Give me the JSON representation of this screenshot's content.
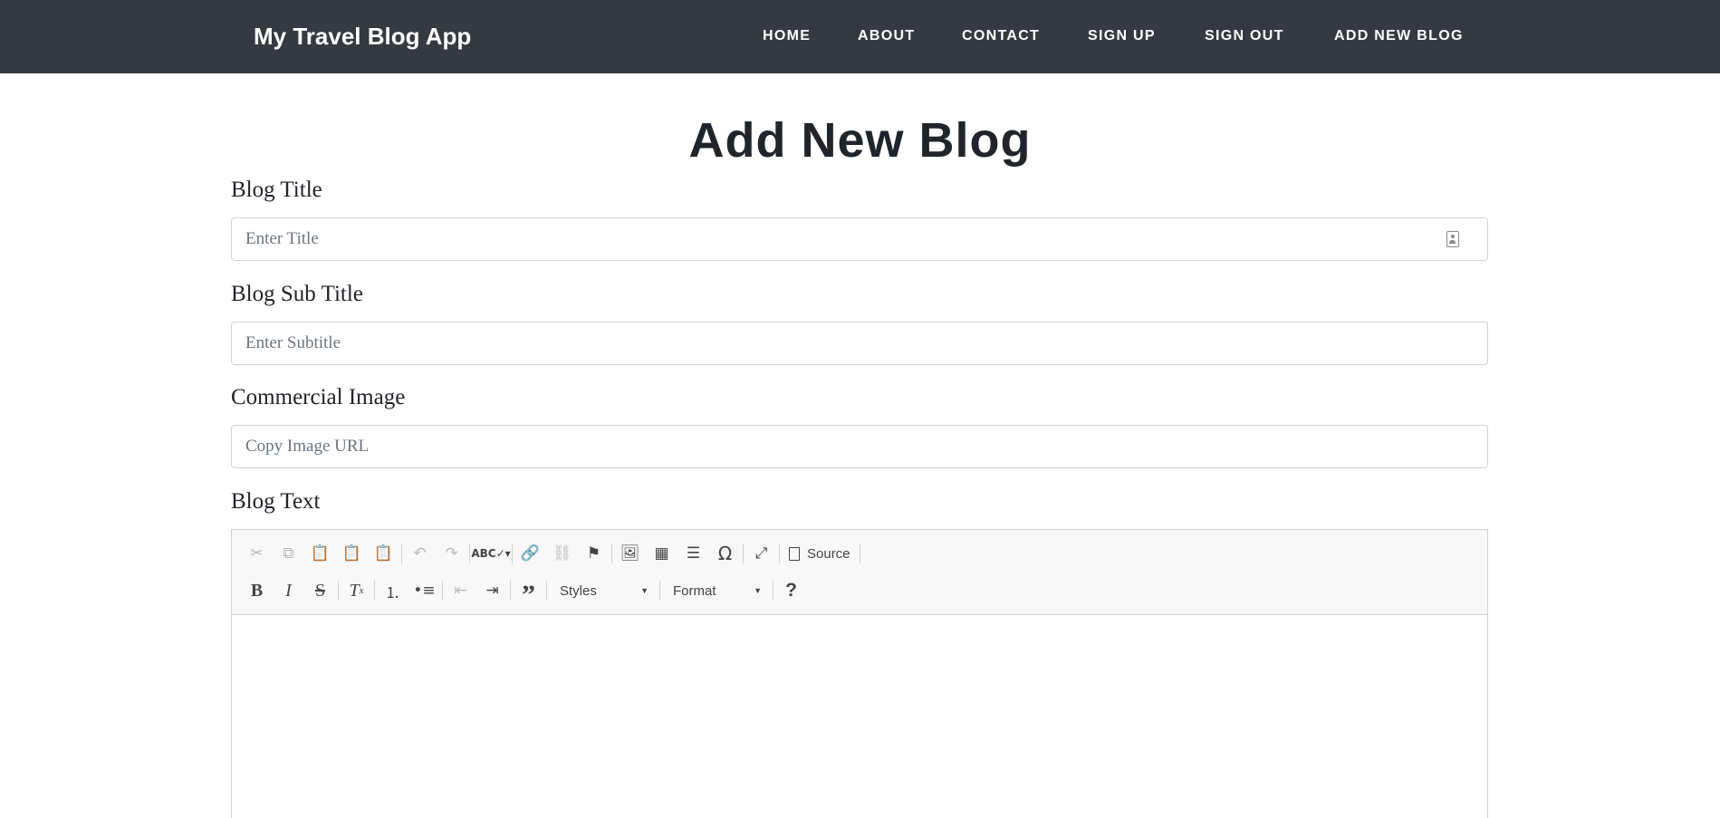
{
  "navbar": {
    "brand": "My Travel Blog App",
    "links": [
      {
        "label": "HOME"
      },
      {
        "label": "ABOUT"
      },
      {
        "label": "CONTACT"
      },
      {
        "label": "SIGN UP"
      },
      {
        "label": "SIGN OUT"
      },
      {
        "label": "ADD NEW BLOG"
      }
    ],
    "background": "#343a40"
  },
  "page": {
    "title": "Add New Blog"
  },
  "form": {
    "blog_title": {
      "label": "Blog Title",
      "placeholder": "Enter Title",
      "value": ""
    },
    "blog_subtitle": {
      "label": "Blog Sub Title",
      "placeholder": "Enter Subtitle",
      "value": ""
    },
    "commercial_image": {
      "label": "Commercial Image",
      "placeholder": "Copy Image URL",
      "value": ""
    },
    "blog_text": {
      "label": "Blog Text"
    }
  },
  "editor": {
    "source_label": "Source",
    "styles_label": "Styles",
    "format_label": "Format",
    "icons_row1": [
      "cut-icon",
      "copy-icon",
      "paste-icon",
      "paste-text-icon",
      "paste-word-icon",
      "undo-icon",
      "redo-icon",
      "spellcheck-icon",
      "link-icon",
      "unlink-icon",
      "anchor-icon",
      "image-icon",
      "table-icon",
      "horizontal-line-icon",
      "special-char-icon",
      "maximize-icon",
      "source-icon"
    ],
    "icons_row2": [
      "bold-icon",
      "italic-icon",
      "strike-icon",
      "remove-format-icon",
      "numbered-list-icon",
      "bulleted-list-icon",
      "outdent-icon",
      "indent-icon",
      "blockquote-icon",
      "styles-dropdown",
      "format-dropdown",
      "help-icon"
    ]
  }
}
